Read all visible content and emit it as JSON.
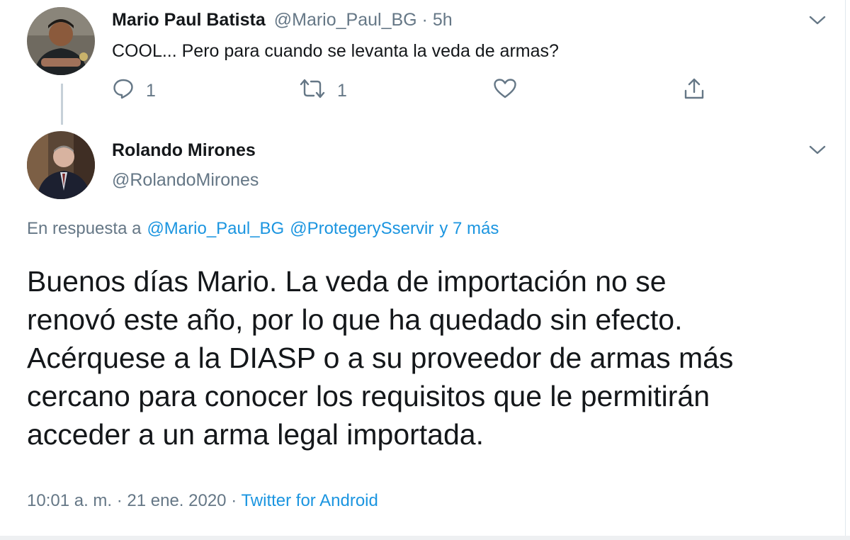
{
  "colors": {
    "link": "#1b95e0",
    "muted": "#657786",
    "text": "#14171a"
  },
  "tweet_1": {
    "author_name": "Mario Paul Batista",
    "author_handle": "@Mario_Paul_BG",
    "separator": "·",
    "time": "5h",
    "text": "COOL... Pero para cuando se levanta la veda de armas?",
    "actions": {
      "reply_icon": "reply-icon",
      "reply_count": "1",
      "retweet_icon": "retweet-icon",
      "retweet_count": "1",
      "like_icon": "heart-icon",
      "share_icon": "share-icon"
    },
    "menu_icon": "chevron-down-icon"
  },
  "tweet_2": {
    "author_name": "Rolando Mirones",
    "author_handle": "@RolandoMirones",
    "menu_icon": "chevron-down-icon",
    "reply_prefix": "En respuesta a",
    "reply_mentions": [
      "@Mario_Paul_BG",
      "@ProtegerySservir"
    ],
    "reply_more": "y 7 más",
    "text_lines": [
      "Buenos días Mario. La veda de importación no se",
      "renovó este año, por lo que ha quedado sin efecto.",
      "Acérquese a la DIASP o a su proveedor de armas más",
      "cercano para conocer los requisitos que le permitirán",
      "acceder a un arma legal importada."
    ],
    "timestamp": "10:01 a. m. · 21 ene. 2020",
    "separator": "·",
    "source": "Twitter for Android"
  }
}
